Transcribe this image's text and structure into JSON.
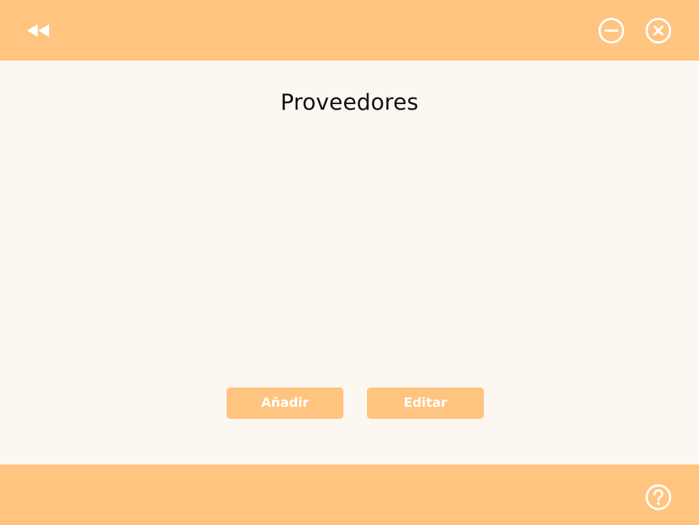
{
  "colors": {
    "accent": "#ffc480",
    "background": "#fdf7f1",
    "title_text": "#111111",
    "button_text": "#ffffff"
  },
  "header": {
    "back_icon": "rewind-icon",
    "minimize_icon": "minimize-circle-icon",
    "close_icon": "close-circle-icon"
  },
  "main": {
    "title": "Proveedores",
    "actions": {
      "add_label": "Añadir",
      "edit_label": "Editar"
    }
  },
  "footer": {
    "help_icon": "help-circle-icon"
  }
}
